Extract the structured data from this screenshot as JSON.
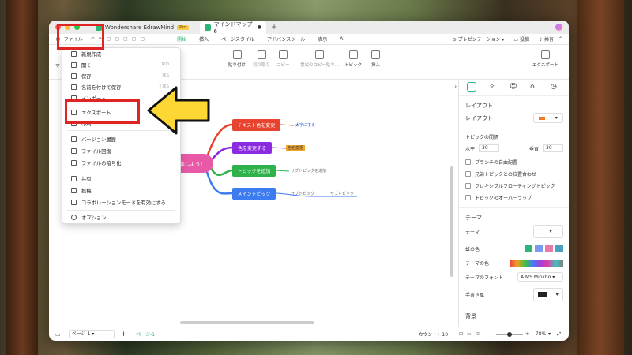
{
  "tabs": [
    {
      "label": "Wondershare EdrawMind",
      "badge": "Pro"
    },
    {
      "label": "マインドマップ6"
    }
  ],
  "menubar": {
    "file_label": "ファイル",
    "tabs": [
      "開始",
      "挿入",
      "ページスタイル",
      "アドバンスツール",
      "表示",
      "AI"
    ],
    "presentation": "プレゼンテーション",
    "post": "投稿",
    "share": "共有"
  },
  "ribbon": {
    "paste": "貼り付け",
    "cut": "切り取り",
    "copy": "コピー",
    "format_copy": "書式のコピー貼り...",
    "topic": "トピック",
    "insert": "挿入",
    "export": "エクスポート",
    "partial": "マ"
  },
  "file_menu": {
    "items": [
      {
        "label": "新規作成",
        "shortcut": "",
        "icon": "new-file-icon"
      },
      {
        "label": "開く",
        "shortcut": "⌘O",
        "icon": "open-folder-icon"
      },
      {
        "label": "保存",
        "shortcut": "⌘S",
        "icon": "save-icon"
      },
      {
        "label": "名前を付けて保存",
        "shortcut": "⇧⌘S",
        "icon": "save-as-icon"
      },
      {
        "label": "インポート",
        "shortcut": "",
        "icon": "import-icon"
      },
      {
        "label": "エクスポート",
        "shortcut": "",
        "icon": "export-icon"
      },
      {
        "label": "印刷",
        "shortcut": "⌘P",
        "icon": "print-icon"
      },
      {
        "label": "バージョン履歴",
        "shortcut": "",
        "icon": "history-icon"
      },
      {
        "label": "ファイル回復",
        "shortcut": "",
        "icon": "recover-icon"
      },
      {
        "label": "ファイルの暗号化",
        "shortcut": "",
        "icon": "lock-icon"
      },
      {
        "label": "共有",
        "shortcut": "",
        "icon": "share-icon"
      },
      {
        "label": "投稿",
        "shortcut": "",
        "icon": "post-icon"
      },
      {
        "label": "コラボレーションモードを有効にする",
        "shortcut": "",
        "icon": "collab-icon"
      },
      {
        "label": "オプション",
        "shortcut": "",
        "icon": "gear-icon"
      }
    ]
  },
  "mindmap": {
    "center": "編集しよう！",
    "nodes": [
      {
        "label": "テキスト色を変更",
        "color": "#e8432e",
        "sub": "太字にする"
      },
      {
        "label": "色を変更する",
        "color": "#8a2be2",
        "sub": "色を変更"
      },
      {
        "label": "トピックを追加",
        "color": "#2fb24a",
        "sub": "サブトピックを追加"
      },
      {
        "label": "メイントピック",
        "color": "#3d7bf0",
        "sub": "サブトピック",
        "sub2": "サブトピック"
      }
    ]
  },
  "right_panel": {
    "layout_header": "レイアウト",
    "layout_label": "レイアウト",
    "spacing_label": "トピックの間隔",
    "h_label": "水平",
    "h_value": "30",
    "v_label": "垂直",
    "v_value": "30",
    "checks": [
      "ブランチの自由配置",
      "兄弟トピックとの位置合わせ",
      "フレキシブルフローティングトピック",
      "トピックのオーバーラップ"
    ],
    "theme_header": "テーマ",
    "theme_label": "テーマ",
    "branch_color": "虹の色",
    "theme_color": "テーマの色",
    "theme_font": "テーマのフォント",
    "font_value": "MS Mincho",
    "hand_drawn": "手書き風",
    "background": "背景"
  },
  "status": {
    "page_select": "ページ-1",
    "page_tab": "ページ-1",
    "count_label": "カウント：10",
    "zoom": "78%"
  },
  "colors": {
    "accent": "#2bb673",
    "highlight": "#e02424",
    "arrow": "#fdd835"
  }
}
